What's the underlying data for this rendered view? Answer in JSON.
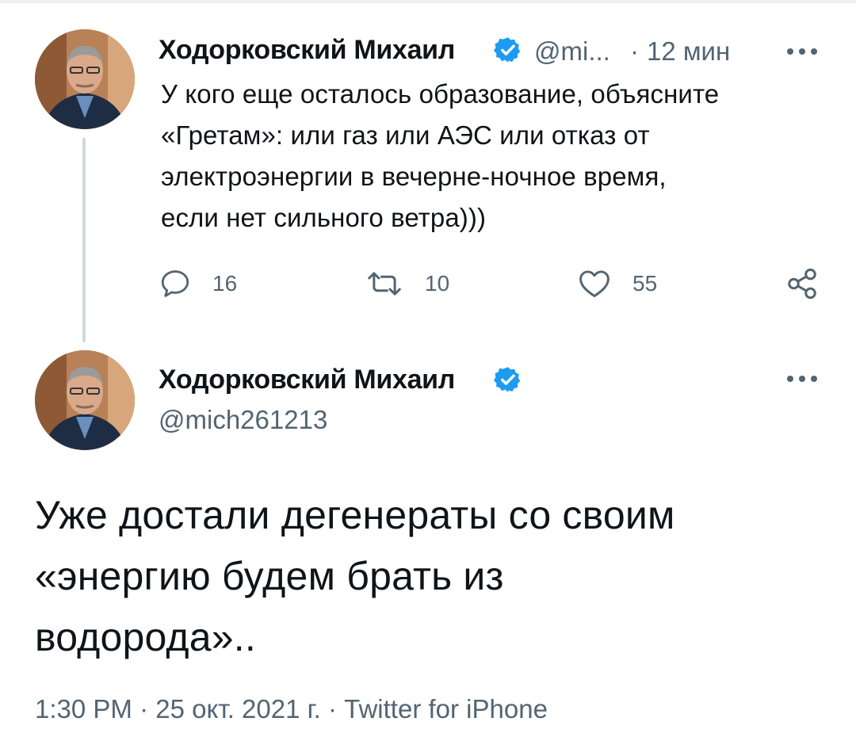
{
  "tweet1": {
    "author_name": "Ходорковский Михаил",
    "handle_truncated": "@mi...",
    "separator": "·",
    "time_ago": "12 мин",
    "text_lines": [
      "У кого еще осталось образование, объясните",
      "«Гретам»: или газ или АЭС или отказ от",
      "электроэнергии в вечерне-ночное время,",
      "если нет сильного ветра)))"
    ],
    "actions": {
      "reply": {
        "icon": "reply-icon",
        "count": "16"
      },
      "retweet": {
        "icon": "retweet-icon",
        "count": "10"
      },
      "like": {
        "icon": "heart-icon",
        "count": "55"
      },
      "share": {
        "icon": "share-icon"
      }
    }
  },
  "tweet2": {
    "author_name": "Ходорковский Михаил",
    "handle": "@mich261213",
    "text_lines": [
      "Уже достали дегенераты со своим",
      "«энергию будем брать из",
      "водорода».."
    ],
    "footer": "1:30 PM · 25 окт. 2021 г. · Twitter for iPhone"
  },
  "colors": {
    "verified_blue": "#1d9bf0",
    "muted_text": "#536471",
    "thread_line": "#cfd9de"
  }
}
